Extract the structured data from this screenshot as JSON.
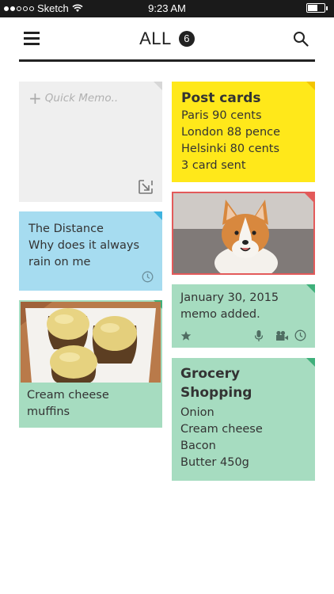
{
  "statusbar": {
    "carrier": "Sketch",
    "time": "9:23 AM"
  },
  "header": {
    "title": "ALL",
    "count": "6"
  },
  "quick_memo": {
    "placeholder": "Quick Memo.."
  },
  "postcards": {
    "title": "Post cards",
    "lines": [
      "Paris 90 cents",
      "London 88 pence",
      "Helsinki 80 cents",
      "3 card sent"
    ]
  },
  "distance": {
    "lines": [
      "The Distance",
      "Why does it always",
      "rain on me"
    ]
  },
  "memo": {
    "lines": [
      "January 30, 2015",
      "memo added."
    ]
  },
  "muffins": {
    "lines": [
      "Cream cheese",
      "muffins"
    ]
  },
  "grocery": {
    "title_lines": [
      "Grocery",
      "Shopping"
    ],
    "items": [
      "Onion",
      "Cream cheese",
      "Bacon",
      "Butter 450g"
    ]
  },
  "colors": {
    "yellow": "#ffe81a",
    "blue": "#a6dcf0",
    "green": "#a6dcc0",
    "gray": "#efefef",
    "photo_border": "#e35a5a"
  }
}
